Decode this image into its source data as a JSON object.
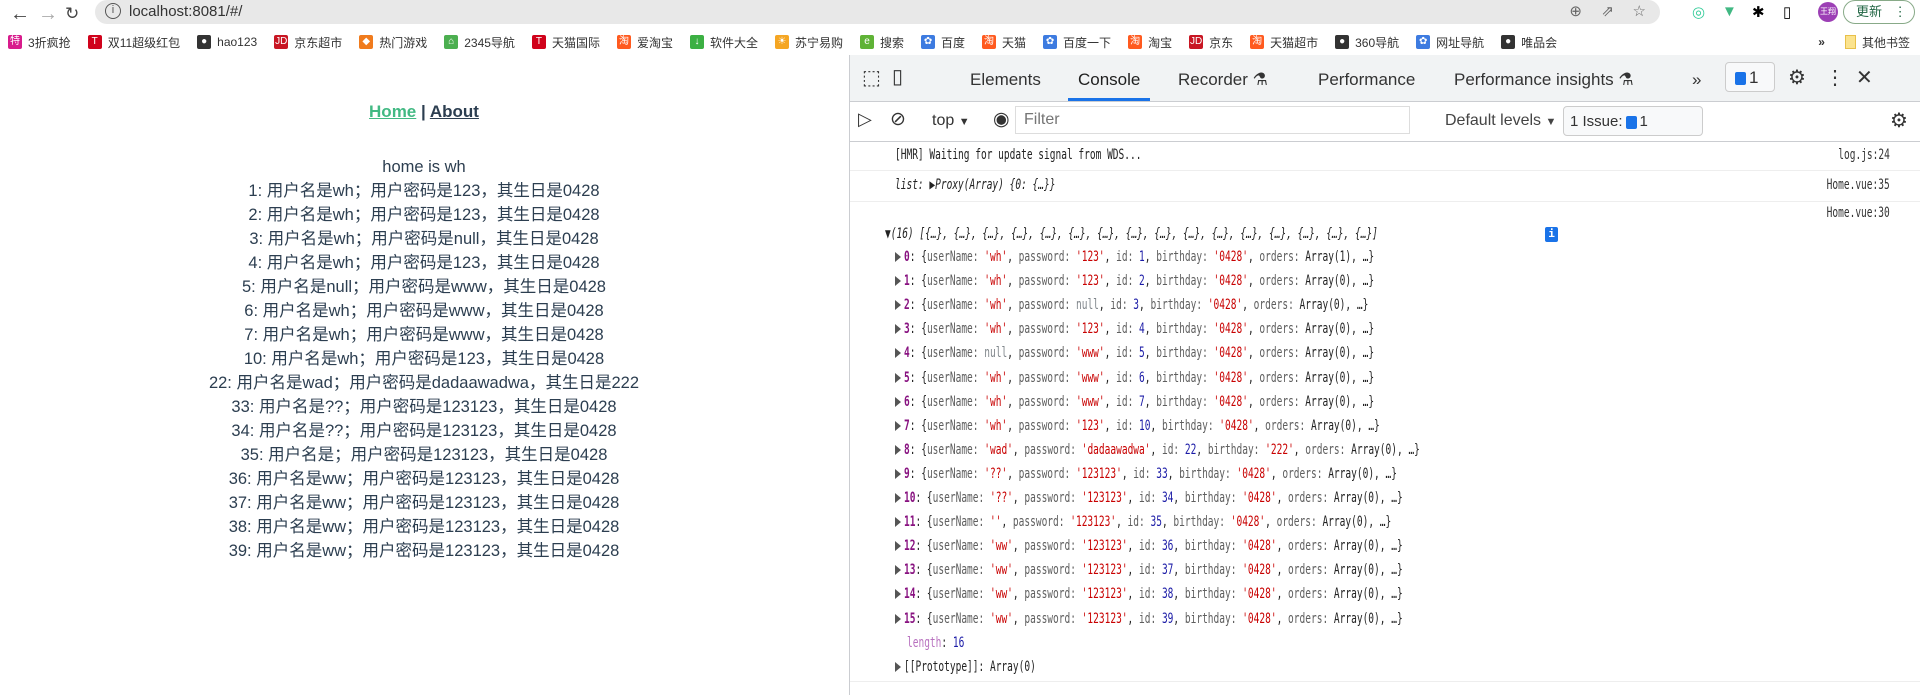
{
  "browser": {
    "url": "localhost:8081/#/",
    "update_label": "更新",
    "avatar_text": "王翔",
    "bookmarks": [
      {
        "label": "3折疯抢",
        "icon": "特",
        "color": "#d81b8c"
      },
      {
        "label": "双11超级红包",
        "icon": "T",
        "color": "#d0021b"
      },
      {
        "label": "hao123",
        "icon": "●",
        "color": "#333"
      },
      {
        "label": "京东超市",
        "icon": "JD",
        "color": "#c81623"
      },
      {
        "label": "热门游戏",
        "icon": "◆",
        "color": "#f07b1d"
      },
      {
        "label": "2345导航",
        "icon": "⌂",
        "color": "#4caf50"
      },
      {
        "label": "天猫国际",
        "icon": "T",
        "color": "#d0021b"
      },
      {
        "label": "爱淘宝",
        "icon": "淘",
        "color": "#ff5a1f"
      },
      {
        "label": "软件大全",
        "icon": "↓",
        "color": "#3cb043"
      },
      {
        "label": "苏宁易购",
        "icon": "☀",
        "color": "#f5a623"
      },
      {
        "label": "搜索",
        "icon": "e",
        "color": "#5fb336"
      },
      {
        "label": "百度",
        "icon": "✿",
        "color": "#3d7be0"
      },
      {
        "label": "天猫",
        "icon": "淘",
        "color": "#ff5a1f"
      },
      {
        "label": "百度一下",
        "icon": "✿",
        "color": "#3d7be0"
      },
      {
        "label": "淘宝",
        "icon": "淘",
        "color": "#ff5a1f"
      },
      {
        "label": "京东",
        "icon": "JD",
        "color": "#c81623"
      },
      {
        "label": "天猫超市",
        "icon": "淘",
        "color": "#ff5a1f"
      },
      {
        "label": "360导航",
        "icon": "●",
        "color": "#333"
      },
      {
        "label": "网址导航",
        "icon": "✿",
        "color": "#3d7be0"
      },
      {
        "label": "唯品会",
        "icon": "●",
        "color": "#333"
      }
    ],
    "other_bookmarks": "其他书签"
  },
  "page": {
    "nav": {
      "home": "Home",
      "separator": "|",
      "about": "About"
    },
    "greeting": "home is wh",
    "lines": [
      "1: 用户名是wh；用户密码是123，其生日是0428",
      "2: 用户名是wh；用户密码是123，其生日是0428",
      "3: 用户名是wh；用户密码是null，其生日是0428",
      "4: 用户名是wh；用户密码是123，其生日是0428",
      "5: 用户名是null；用户密码是www，其生日是0428",
      "6: 用户名是wh；用户密码是www，其生日是0428",
      "7: 用户名是wh；用户密码是www，其生日是0428",
      "10: 用户名是wh；用户密码是123，其生日是0428",
      "22: 用户名是wad；用户密码是dadaawadwa，其生日是222",
      "33: 用户名是??；用户密码是123123，其生日是0428",
      "34: 用户名是??；用户密码是123123，其生日是0428",
      "35: 用户名是；用户密码是123123，其生日是0428",
      "36: 用户名是ww；用户密码是123123，其生日是0428",
      "37: 用户名是ww；用户密码是123123，其生日是0428",
      "38: 用户名是ww；用户密码是123123，其生日是0428",
      "39: 用户名是ww；用户密码是123123，其生日是0428"
    ]
  },
  "devtools": {
    "tabs": [
      "Elements",
      "Console",
      "Recorder",
      "Performance",
      "Performance insights"
    ],
    "active_tab": "Console",
    "issues_badge": "1",
    "context": "top",
    "filter_placeholder": "Filter",
    "levels": "Default levels",
    "issue_label": "1 Issue:",
    "issue_count": "1",
    "messages": [
      {
        "text": "[HMR] Waiting for update signal from WDS...",
        "source": "log.js:24"
      },
      {
        "text": "list: ▶Proxy(Array) {0: {…}}",
        "source": "Home.vue:35"
      },
      {
        "text": "▼(16) [{…}, {…}, {…}, {…}, {…}, {…}, {…}, {…}, {…}, {…}, {…}, {…}, {…}, {…}, {…}, {…}]",
        "source": "Home.vue:30"
      }
    ],
    "items": [
      {
        "i": "0",
        "userName": "'wh'",
        "password": "'123'",
        "id": "1",
        "birthday": "'0428'",
        "orders": "Array(1)"
      },
      {
        "i": "1",
        "userName": "'wh'",
        "password": "'123'",
        "id": "2",
        "birthday": "'0428'",
        "orders": "Array(0)"
      },
      {
        "i": "2",
        "userName": "'wh'",
        "password": "null",
        "id": "3",
        "birthday": "'0428'",
        "orders": "Array(0)"
      },
      {
        "i": "3",
        "userName": "'wh'",
        "password": "'123'",
        "id": "4",
        "birthday": "'0428'",
        "orders": "Array(0)"
      },
      {
        "i": "4",
        "userName": "null",
        "password": "'www'",
        "id": "5",
        "birthday": "'0428'",
        "orders": "Array(0)"
      },
      {
        "i": "5",
        "userName": "'wh'",
        "password": "'www'",
        "id": "6",
        "birthday": "'0428'",
        "orders": "Array(0)"
      },
      {
        "i": "6",
        "userName": "'wh'",
        "password": "'www'",
        "id": "7",
        "birthday": "'0428'",
        "orders": "Array(0)"
      },
      {
        "i": "7",
        "userName": "'wh'",
        "password": "'123'",
        "id": "10",
        "birthday": "'0428'",
        "orders": "Array(0)"
      },
      {
        "i": "8",
        "userName": "'wad'",
        "password": "'dadaawadwa'",
        "id": "22",
        "birthday": "'222'",
        "orders": "Array(0)"
      },
      {
        "i": "9",
        "userName": "'??'",
        "password": "'123123'",
        "id": "33",
        "birthday": "'0428'",
        "orders": "Array(0)"
      },
      {
        "i": "10",
        "userName": "'??'",
        "password": "'123123'",
        "id": "34",
        "birthday": "'0428'",
        "orders": "Array(0)"
      },
      {
        "i": "11",
        "userName": "''",
        "password": "'123123'",
        "id": "35",
        "birthday": "'0428'",
        "orders": "Array(0)"
      },
      {
        "i": "12",
        "userName": "'ww'",
        "password": "'123123'",
        "id": "36",
        "birthday": "'0428'",
        "orders": "Array(0)"
      },
      {
        "i": "13",
        "userName": "'ww'",
        "password": "'123123'",
        "id": "37",
        "birthday": "'0428'",
        "orders": "Array(0)"
      },
      {
        "i": "14",
        "userName": "'ww'",
        "password": "'123123'",
        "id": "38",
        "birthday": "'0428'",
        "orders": "Array(0)"
      },
      {
        "i": "15",
        "userName": "'ww'",
        "password": "'123123'",
        "id": "39",
        "birthday": "'0428'",
        "orders": "Array(0)"
      }
    ],
    "length_key": "length",
    "length_value": "16",
    "prototype": "[[Prototype]]: Array(0)"
  }
}
